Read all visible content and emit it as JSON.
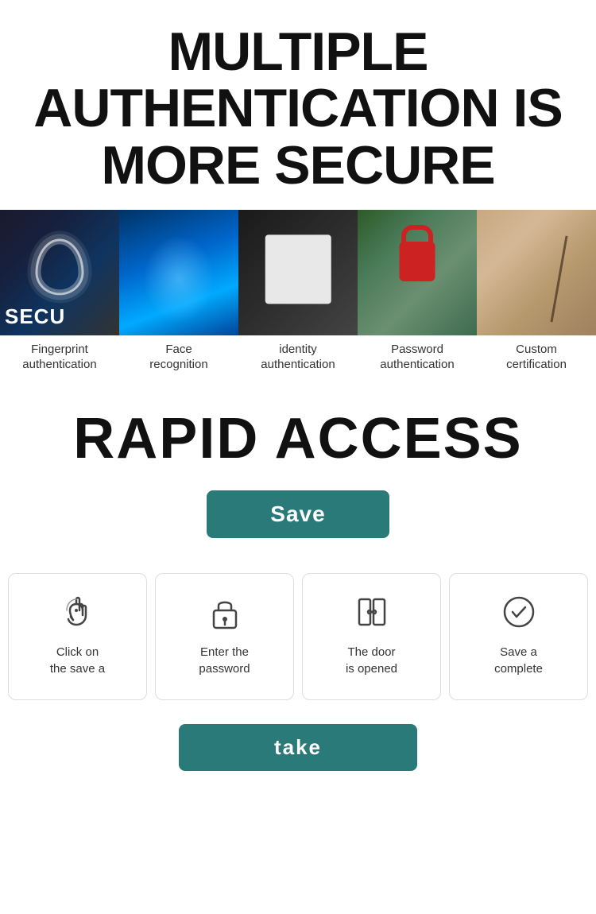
{
  "header": {
    "title": "MULTIPLE AUTHENTICATION IS MORE SECURE"
  },
  "gallery": {
    "items": [
      {
        "label": "Fingerprint\nauthentication",
        "img_class": "img-fingerprint",
        "alt": "fingerprint"
      },
      {
        "label": "Face\nrecognition",
        "img_class": "img-face",
        "alt": "face recognition"
      },
      {
        "label": "identity\nauthentication",
        "img_class": "img-identity",
        "alt": "identity"
      },
      {
        "label": "Password\nauthentication",
        "img_class": "img-password",
        "alt": "password"
      },
      {
        "label": "Custom\ncertification",
        "img_class": "img-custom",
        "alt": "custom"
      }
    ]
  },
  "rapid_access": {
    "title": "RAPID ACCESS",
    "save_label": "Save"
  },
  "steps": [
    {
      "icon": "finger-touch",
      "label": "Click on\nthe save a"
    },
    {
      "icon": "lock",
      "label": "Enter the\npassword"
    },
    {
      "icon": "door",
      "label": "The door\nis opened"
    },
    {
      "icon": "check-circle",
      "label": "Save a\ncomplete"
    }
  ],
  "take_button": {
    "label": "take"
  }
}
